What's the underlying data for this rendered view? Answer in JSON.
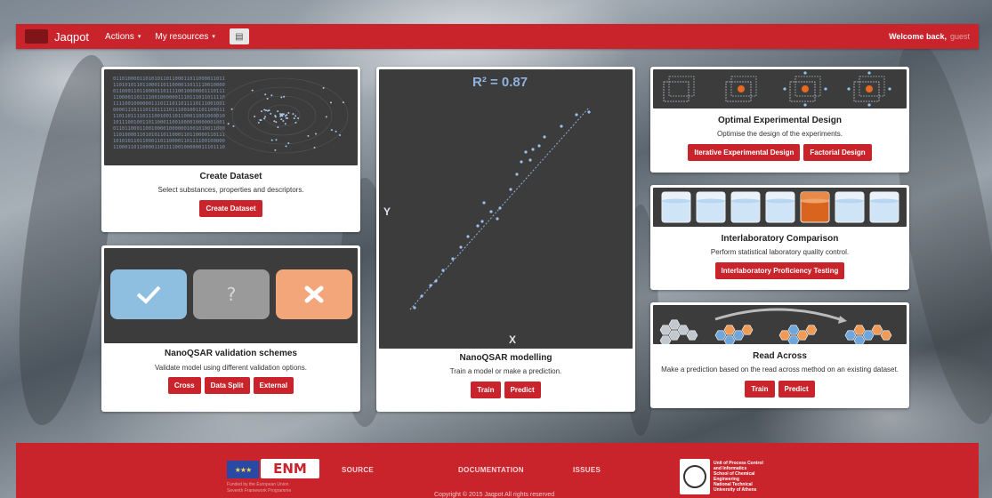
{
  "navbar": {
    "brand": "Jaqpot",
    "menu": [
      {
        "label": "Actions"
      },
      {
        "label": "My resources"
      }
    ],
    "welcome": "Welcome back,",
    "user": "guest"
  },
  "cards": {
    "create_dataset": {
      "title": "Create Dataset",
      "description": "Select substances, properties and descriptors.",
      "buttons": [
        "Create Dataset"
      ]
    },
    "validation": {
      "title": "NanoQSAR validation schemes",
      "description": "Validate model using different validation options.",
      "buttons": [
        "Cross",
        "Data Split",
        "External"
      ],
      "image": {
        "tiles": [
          "check-icon",
          "question-icon",
          "cross-icon"
        ],
        "tile_colors": [
          "#8fbfe0",
          "#9a9a9a",
          "#f2a67a"
        ]
      }
    },
    "modelling": {
      "title": "NanoQSAR modelling",
      "description": "Train a model or make a prediction.",
      "buttons": [
        "Train",
        "Predict"
      ],
      "image": {
        "r2_label": "R² = 0.87",
        "x_label": "X",
        "y_label": "Y"
      }
    },
    "experimental_design": {
      "title": "Optimal Experimental Design",
      "description": "Optimise the design of the experiments.",
      "buttons": [
        "Iterative Experimental Design",
        "Factorial Design"
      ]
    },
    "interlab": {
      "title": "Interlaboratory Comparison",
      "description": "Perform statistical laboratory quality control.",
      "buttons": [
        "Interlaboratory Proficiency Testing"
      ]
    },
    "read_across": {
      "title": "Read Across",
      "description": "Make a prediction based on the read across method on an existing dataset.",
      "buttons": [
        "Train",
        "Predict"
      ]
    }
  },
  "footer": {
    "links": [
      "SOURCE",
      "DOCUMENTATION",
      "ISSUES"
    ],
    "copyright": "Copyright © 2015 Jaqpot All rights reserved",
    "enm_logo": "ENM",
    "eu_caption": [
      "Funded by the European Union",
      "Seventh Framework Programme"
    ],
    "ntua": [
      "Unit of Process Control",
      "and Informatics",
      "School of Chemical",
      "Engineering",
      "National Technical",
      "University of Athens"
    ]
  },
  "colors": {
    "brand_red": "#c9242b",
    "card_bg": "#ffffff",
    "image_bg": "#3c3c3c"
  },
  "binary_text": "0110100001101010110110001101100001101111001000000111011101101111011100100110110001100100001000000100101001100001011100010111000001101111011101000010000001100100011000010111010001100001001000000110010001100101011100110110001101110010011010010111000001110100011011110111001001110011"
}
